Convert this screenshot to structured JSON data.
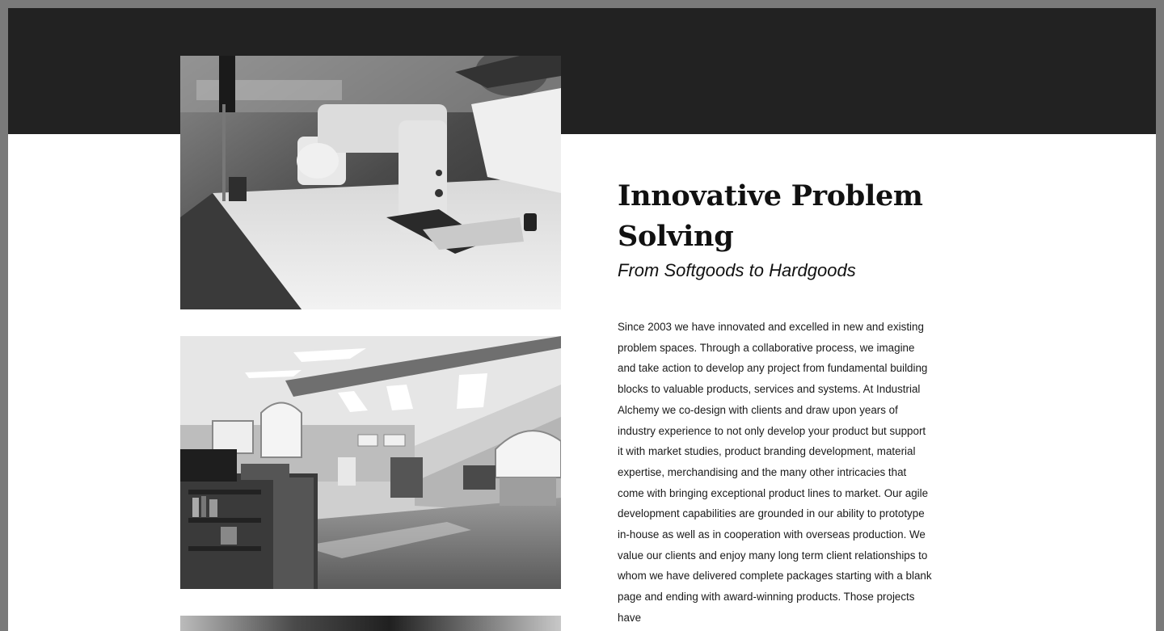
{
  "section": {
    "heading": "Innovative Problem Solving",
    "subheading": "From Softgoods to Hardgoods",
    "body": "Since 2003 we have innovated and excelled in new and existing problem spaces. Through a collaborative process, we imagine and take action to develop any project from fundamental building blocks to valuable products, services and systems. At Industrial Alchemy we co-design with clients and draw upon years of industry experience to not only develop your product but support it with market studies, product branding development, material expertise, merchandising and the many other intricacies that come with bringing exceptional product lines to market. Our agile development capabilities are grounded in our ability to prototype in-house as well as in cooperation with overseas production. We value our clients and enjoy many long term client relationships to whom we have delivered complete packages starting with a blank page and ending with award-winning products. Those projects have"
  },
  "photos": [
    {
      "name": "sewing-machine-photo",
      "subject": "person sewing at industrial sewing machine"
    },
    {
      "name": "studio-interior-photo",
      "subject": "open studio office interior with skylights"
    },
    {
      "name": "partial-photo",
      "subject": "partially visible photo"
    }
  ],
  "colors": {
    "band": "#222222",
    "frame": "#7a7a7a",
    "text": "#111111"
  }
}
